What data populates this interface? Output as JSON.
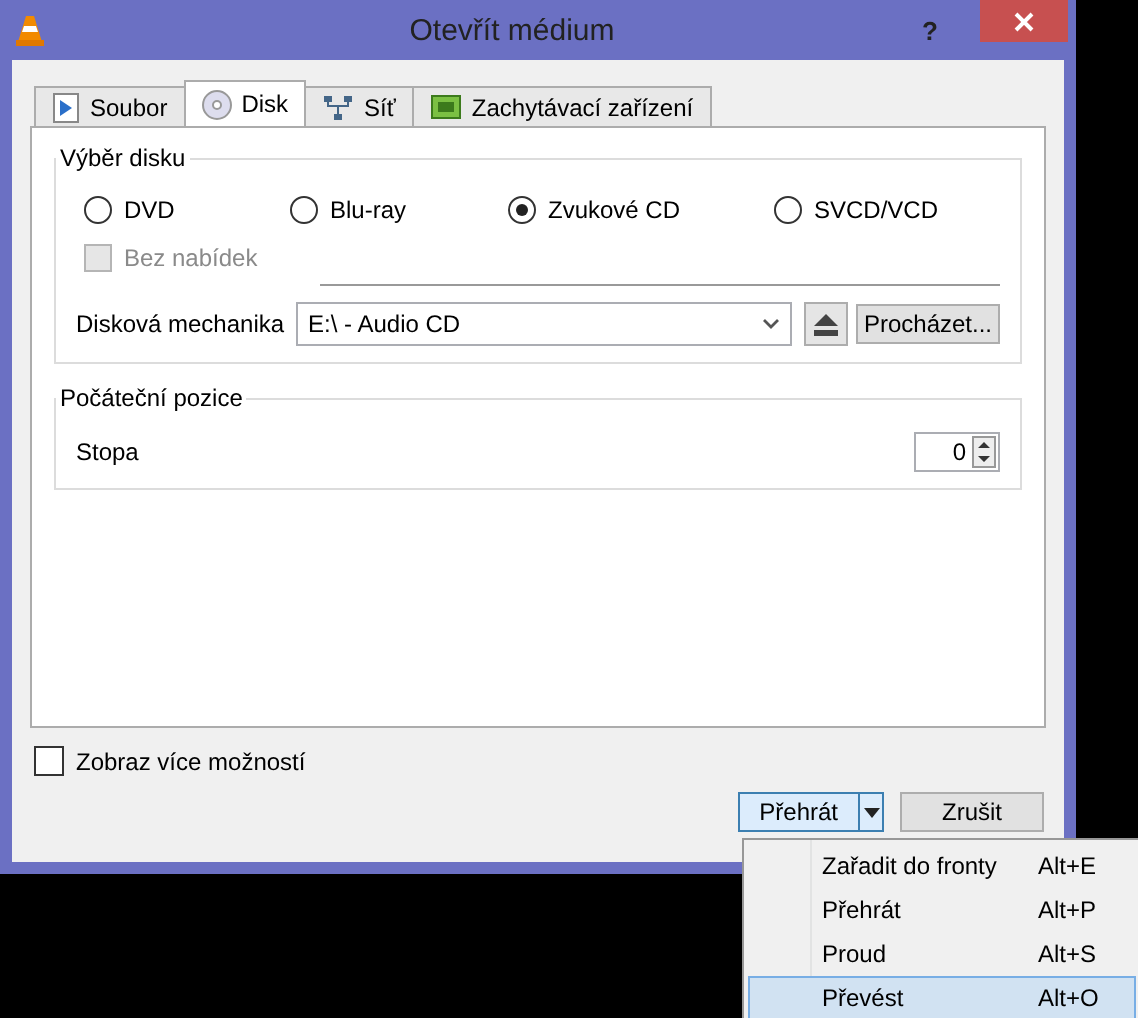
{
  "window": {
    "title": "Otevřít médium",
    "help": "?"
  },
  "tabs": [
    {
      "label": "Soubor",
      "kind": "file",
      "selected": false
    },
    {
      "label": "Disk",
      "kind": "disc",
      "selected": true
    },
    {
      "label": "Síť",
      "kind": "network",
      "selected": false
    },
    {
      "label": "Zachytávací zařízení",
      "kind": "capture",
      "selected": false
    }
  ],
  "disc_selection": {
    "title": "Výběr disku",
    "types": [
      {
        "label": "DVD",
        "selected": false
      },
      {
        "label": "Blu-ray",
        "selected": false
      },
      {
        "label": "Zvukové CD",
        "selected": true
      },
      {
        "label": "SVCD/VCD",
        "selected": false
      }
    ],
    "no_menus": {
      "label": "Bez nabídek",
      "checked": false,
      "disabled": true
    },
    "drive_label": "Disková mechanika",
    "drive": "E:\\ - Audio CD",
    "browse": "Procházet..."
  },
  "start_position": {
    "title": "Počáteční pozice",
    "track_label": "Stopa",
    "track": "0"
  },
  "more_options": {
    "label": "Zobraz více možností",
    "checked": false
  },
  "buttons": {
    "play": "Přehrát",
    "cancel": "Zrušit"
  },
  "menu": [
    {
      "label": "Zařadit do fronty",
      "shortcut": "Alt+E",
      "selected": false
    },
    {
      "label": "Přehrát",
      "shortcut": "Alt+P",
      "selected": false
    },
    {
      "label": "Proud",
      "shortcut": "Alt+S",
      "selected": false
    },
    {
      "label": "Převést",
      "shortcut": "Alt+O",
      "selected": true
    }
  ]
}
